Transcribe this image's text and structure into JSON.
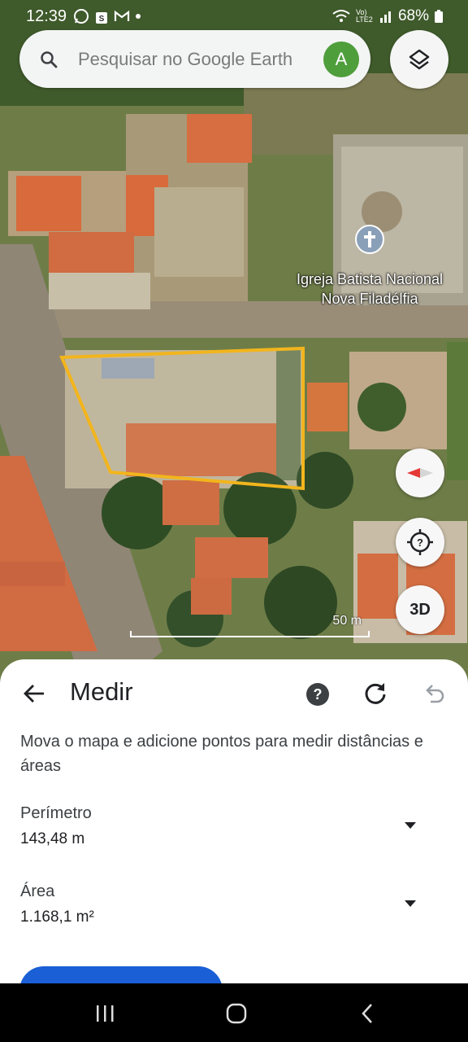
{
  "status_bar": {
    "time": "12:39",
    "battery": "68%",
    "network": "Vo) LTE2"
  },
  "search": {
    "placeholder": "Pesquisar no Google Earth",
    "avatar_letter": "A"
  },
  "map": {
    "place_name_line1": "Igreja Batista Nacional",
    "place_name_line2": "Nova Filadélfia",
    "scale_label": "50 m",
    "button_3d": "3D",
    "polygon_color": "#f2b51d"
  },
  "measure": {
    "title": "Medir",
    "help": "?",
    "instruction": "Mova o mapa e adicione pontos para medir distâncias e áreas",
    "perimeter_label": "Perímetro",
    "perimeter_value": "143,48 m",
    "area_label": "Área",
    "area_value": "1.168,1 m²"
  },
  "colors": {
    "accent_blue": "#1a5fd6",
    "avatar_green": "#4f9e3c"
  }
}
